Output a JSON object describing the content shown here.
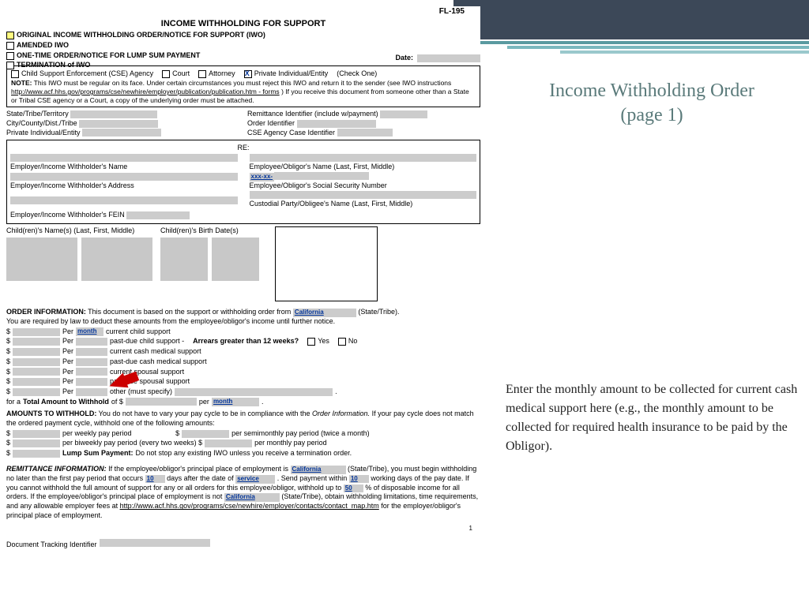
{
  "form": {
    "code": "FL-195",
    "title": "INCOME WITHHOLDING FOR SUPPORT",
    "types": {
      "original": "ORIGINAL INCOME WITHHOLDING ORDER/NOTICE FOR SUPPORT (IWO)",
      "amended": "AMENDED IWO",
      "onetime": "ONE-TIME ORDER/NOTICE FOR LUMP SUM PAYMENT",
      "termination": "TERMINATION of IWO"
    },
    "date_label": "Date:",
    "requestors": {
      "cse": "Child Support Enforcement (CSE) Agency",
      "court": "Court",
      "attorney": "Attorney",
      "private": "Private Individual/Entity",
      "check_one": "(Check One)"
    },
    "note": {
      "label": "NOTE:",
      "text": "This IWO must be regular on its face. Under certain circumstances you must reject this IWO and return it to the sender (see IWO instructions ",
      "link": "http://www.acf.hhs.gov/programs/cse/newhire/employer/publication/publication.htm - forms",
      "text2": ") If you receive this document from someone other than a State or Tribal CSE agency or a Court, a copy of the underlying order must be attached."
    },
    "ids": {
      "state_label": "State/Tribe/Territory",
      "city_label": "City/County/Dist./Tribe",
      "private_label": "Private Individual/Entity",
      "remit_label": "Remittance Identifier (include w/payment)",
      "order_label": "Order Identifier",
      "cse_label": "CSE Agency Case Identifier"
    },
    "re": {
      "label": "RE:",
      "emp_name": "Employer/Income Withholder's Name",
      "emp_addr": "Employer/Income Withholder's Address",
      "emp_fein": "Employer/Income Withholder's FEIN",
      "obl_name": "Employee/Obligor's Name (Last, First, Middle)",
      "ssn_prefix": "xxx-xx-",
      "obl_ssn": "Employee/Obligor's Social Security Number",
      "cust_name": "Custodial Party/Obligee's Name (Last, First, Middle)"
    },
    "children": {
      "names": "Child(ren)'s Name(s) (Last, First, Middle)",
      "dates": "Child(ren)'s Birth Date(s)"
    },
    "order_info": {
      "label": "ORDER INFORMATION:",
      "text1": "This document is based on the support or withholding order from",
      "state": "California",
      "state_suffix": "(State/Tribe).",
      "text2": "You are required by law to deduct these amounts from the employee/obligor's income until further notice.",
      "per_month": "month",
      "line1": "current child support",
      "line2": "past-due child support -",
      "arrears": "Arrears greater than 12 weeks?",
      "yes": "Yes",
      "no": "No",
      "line3": "current cash medical support",
      "line4": "past-due cash medical support",
      "line5": "current spousal support",
      "line6": "past-due spousal support",
      "line7": "other (must specify)",
      "total_label": "for a",
      "total_bold": "Total Amount to Withhold",
      "total_of": "of $",
      "per": "Per",
      "month": "month"
    },
    "amounts": {
      "label": "AMOUNTS TO WITHHOLD:",
      "text": "You do not have to vary your pay cycle to be in compliance with the",
      "italic": "Order Information.",
      "text2": "If your pay cycle does not match the ordered payment cycle, withhold one of the following amounts:",
      "weekly": "per weekly pay period",
      "semi": "per semimonthly pay period (twice a month)",
      "biweekly": "per biweekly pay period (every two weeks) $",
      "monthly": "per monthly pay period",
      "lump_label": "Lump Sum Payment:",
      "lump_text": "Do not stop any existing IWO unless you receive a termination order."
    },
    "remit": {
      "label": "REMITTANCE INFORMATION:",
      "text1": "If the employee/obligor's principal place of employment is",
      "state": "California",
      "suffix1": "(State/Tribe),",
      "text2": "you must begin withholding no later than the first pay period that occurs",
      "days": "10",
      "text3": "days after the date of",
      "service": "service",
      "text4": ". Send payment within",
      "working": "10",
      "text5": "working days of the pay date. If you cannot withhold the full amount of support for any or all orders for this employee/obligor, withhold up to",
      "percent": "50",
      "text6": "% of disposable income for all orders. If the employee/obligor's principal place of employment is not",
      "state2": "California",
      "text7": "(State/Tribe), obtain withholding limitations, time requirements, and any allowable employer fees at",
      "link": "http://www.acf.hhs.gov/programs/cse/newhire/employer/contacts/contact_map.htm",
      "text8": "for the employer/obligor's principal place of employment."
    },
    "page_num": "1",
    "tracking": "Document Tracking Identifier"
  },
  "side": {
    "title_line1": "Income Withholding Order",
    "title_line2": "(page 1)",
    "body": "Enter the monthly amount to be collected for current cash medical support here (e.g., the monthly amount to be collected for required health insurance to be paid by the Obligor)."
  }
}
